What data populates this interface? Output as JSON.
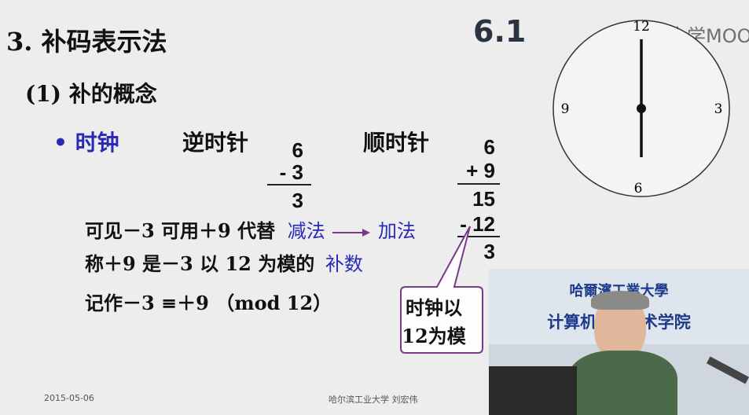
{
  "title": "3. 补码表示法",
  "subtitle": "(1) 补的概念",
  "bullet": "• 时钟",
  "headings": {
    "ccw": "逆时针",
    "cw": "顺时针"
  },
  "ccw_calc": {
    "top": "6",
    "op": "- 3",
    "result": "3"
  },
  "cw_calc": {
    "top": "6",
    "op": "+ 9",
    "sum": "15",
    "minus": "- 12",
    "result": "3"
  },
  "line1": {
    "text": "可见－3 可用＋9 代替",
    "sub": "减法",
    "add": "加法"
  },
  "line2": {
    "text": "称＋9 是－3 以 12 为模的",
    "term": "补数"
  },
  "line3": "记作－3 ≡＋9 （mod 12）",
  "callout": {
    "line1": "时钟以",
    "line2": "12为模"
  },
  "clock": {
    "n12": "12",
    "n3": "3",
    "n6": "6",
    "n9": "9"
  },
  "badge": "6.1",
  "logo": "中国大学MOOC",
  "video_banner": {
    "line1": "哈爾濱工業大學",
    "line2": "计算机  与技术学院"
  },
  "footer": {
    "date": "2015-05-06",
    "author": "哈尔滨工业大学  刘宏伟"
  },
  "colors": {
    "accent": "#2a2ab8",
    "callout_border": "#7a3a8a",
    "badge": "#2a3440"
  }
}
